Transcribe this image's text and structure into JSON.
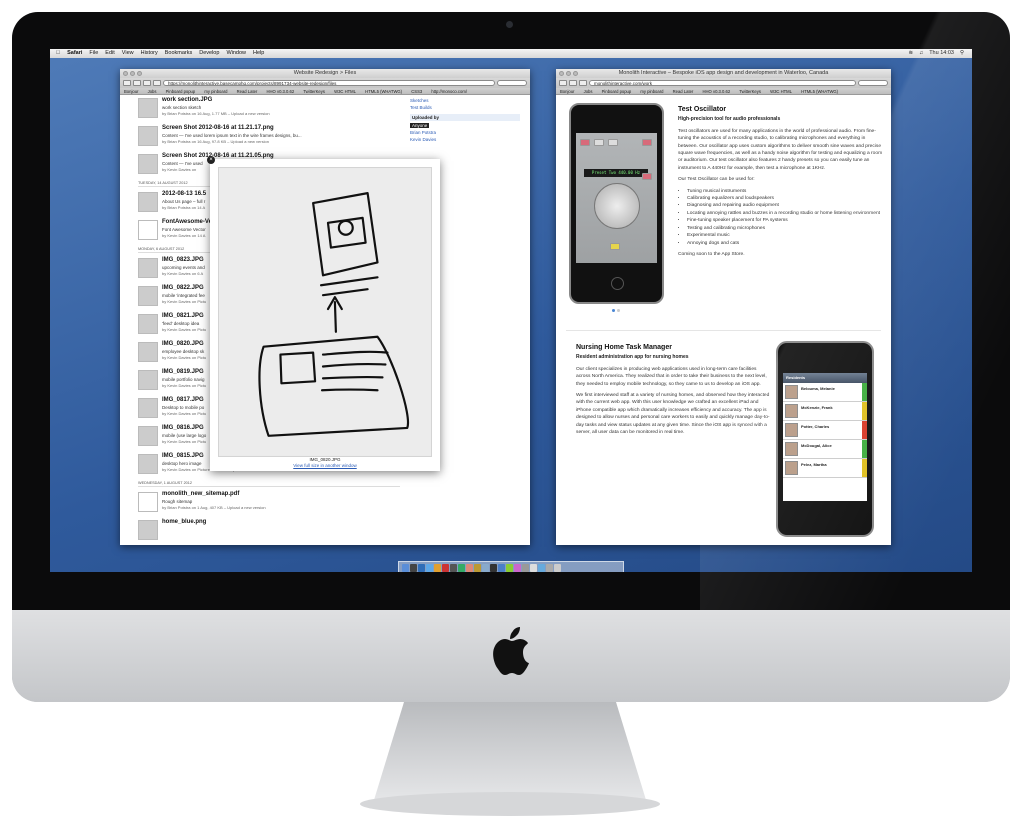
{
  "menubar": {
    "app": "Safari",
    "items": [
      "File",
      "Edit",
      "View",
      "History",
      "Bookmarks",
      "Develop",
      "Window",
      "Help"
    ],
    "clock": "Thu 14:03"
  },
  "window1": {
    "title": "Website Redesign > Files",
    "url": "https://monolithinteractive.basecamphq.com/projects/8991734-website-redesign/files",
    "bookmarks": [
      "Bonjour",
      "Jobs",
      "Pinboard popup",
      "my pinboard",
      "Read Later",
      "HHO v0.3.0.62",
      "TwitterKeys",
      "W3C HTML",
      "HTML5 (WHATWG)",
      "CSS3",
      "http://monoco.com/"
    ],
    "files": [
      {
        "name": "work section.JPG",
        "desc": "work section sketch",
        "meta": "by Brian Potstra on 16 Aug, 1.77 MB – Upload a new version"
      },
      {
        "name": "Screen Shot 2012-08-16 at 11.21.17.png",
        "desc": "Content — I've used lorem ipsum text in the wire frames designs, bu...",
        "meta": "by Brian Potstra on 16 Aug, 97.8 KB – Upload a new version"
      },
      {
        "name": "Screen Shot 2012-08-16 at 11.21.05.png",
        "desc": "Content — I've used",
        "meta": "by Kevin Davies on"
      }
    ],
    "day1": "Tuesday, 14 August 2012",
    "files2": [
      {
        "name": "2012-08-13 16.5",
        "desc": "About Us page – full r",
        "meta": "by Brian Potstra on 14 A"
      },
      {
        "name": "FontAwesome-Ve",
        "desc": "Font Awesome Vector",
        "meta": "by Kevin Davies on 14 A"
      }
    ],
    "day2": "Monday, 6 August 2012",
    "files3": [
      {
        "name": "IMG_0823.JPG",
        "desc": "upcoming events and",
        "meta": "by Kevin Davies on 6 A"
      },
      {
        "name": "IMG_0822.JPG",
        "desc": "mobile 'integrated fee",
        "meta": "by Kevin Davies on Pictu"
      },
      {
        "name": "IMG_0821.JPG",
        "desc": "'feed' desktop idea",
        "meta": "by Kevin Davies on Pictu"
      },
      {
        "name": "IMG_0820.JPG",
        "desc": "employee desktop sk",
        "meta": "by Kevin Davies on Pictu"
      },
      {
        "name": "IMG_0819.JPG",
        "desc": "mobile portfolio navig",
        "meta": "by Kevin Davies on Pictu"
      },
      {
        "name": "IMG_0817.JPG",
        "desc": "Desktop to mobile po",
        "meta": "by Kevin Davies on Pictu"
      },
      {
        "name": "IMG_0816.JPG",
        "desc": "mobile (use large logo",
        "meta": "by Kevin Davies on Pictu"
      },
      {
        "name": "IMG_0815.JPG",
        "desc": "desktop hero image",
        "meta": "by Kevin Davies on Pictures 1.1 MB – Upload a new version"
      }
    ],
    "day3": "Wednesday, 1 August 2012",
    "files4": [
      {
        "name": "monolith_new_sitemap.pdf",
        "desc": "Rough sitemap",
        "meta": "by Brian Potstra on 1 Aug, 407 KB – Upload a new version"
      },
      {
        "name": "home_blue.png",
        "desc": "",
        "meta": ""
      }
    ],
    "sidebar": {
      "top_links": [
        "Sketches",
        "Test Builds"
      ],
      "uploaded_by": "Uploaded by",
      "selected": "Anyone",
      "people": [
        "Brian Potstra",
        "Kevin Davies"
      ]
    },
    "lightbox": {
      "caption": "IMG_0820.JPG",
      "link": "View full size in another window"
    }
  },
  "window2": {
    "title": "Monolith Interactive – Bespoke iOS app design and development in Waterloo, Canada",
    "url": "monolithinteractive.com/work",
    "oscillator": {
      "display": "Preset Two 440.00 Hz",
      "title": "Test Oscillator",
      "subtitle": "High-precision tool for audio professionals",
      "p1": "Test oscillators are used for many applications in the world of professional audio. From fine-tuning the acoustics of a recording studio, to calibrating microphones and everything in between. Our oscillator app uses custom algorithms to deliver smooth sine waves and precise square wave frequencies, as well as a handy noise algorithm for testing and equalizing a room or auditorium. Our test oscillator also features 2 handy presets so you can easily tune an instrument to A 440Hz for example, then test a microphone at 1KHz.",
      "p2": "Our Test Oscillator can be used for:",
      "list": [
        "Tuning musical instruments",
        "Calibrating equalizers and loudspeakers",
        "Diagnosing and repairing audio equipment",
        "Locating annoying rattles and buzzes in a recording studio or home listening environment",
        "Fine-tuning speaker placement for PA systems",
        "Testing and calibrating microphones",
        "Experimental music",
        "Annoying dogs and cats"
      ],
      "p3": "Coming soon to the App Store."
    },
    "nursing": {
      "title": "Nursing Home Task Manager",
      "subtitle": "Resident administration app for nursing homes",
      "p1": "Our client specializes in producing web applications used in long-term care facilities across North America. They realized that in order to take their business to the next level, they needed to employ mobile technology, so they came to us to develop an iOS app.",
      "p2": "We first interviewed staff at a variety of nursing homes, and observed how they interacted with the current web app. With this user knowledge we crafted an excellent iPad and iPhone compatible app which dramatically increases efficiency and accuracy. The app is designed to allow nurses and personal care workers to easily and quickly manage day-to-day tasks and view status updates at any given time. Since the iOS app is synced with a server, all user data can be monitored in real time.",
      "app_header": "Residents",
      "residents": [
        "Belouma, Melanie",
        "McKenzie, Frank",
        "Potter, Charles",
        "McDougal, Alice",
        "Pelez, Martha"
      ],
      "status_colors": [
        "#3fae3f",
        "#e0c020",
        "#d83a2a",
        "#3fae3f",
        "#e0c020"
      ]
    }
  }
}
